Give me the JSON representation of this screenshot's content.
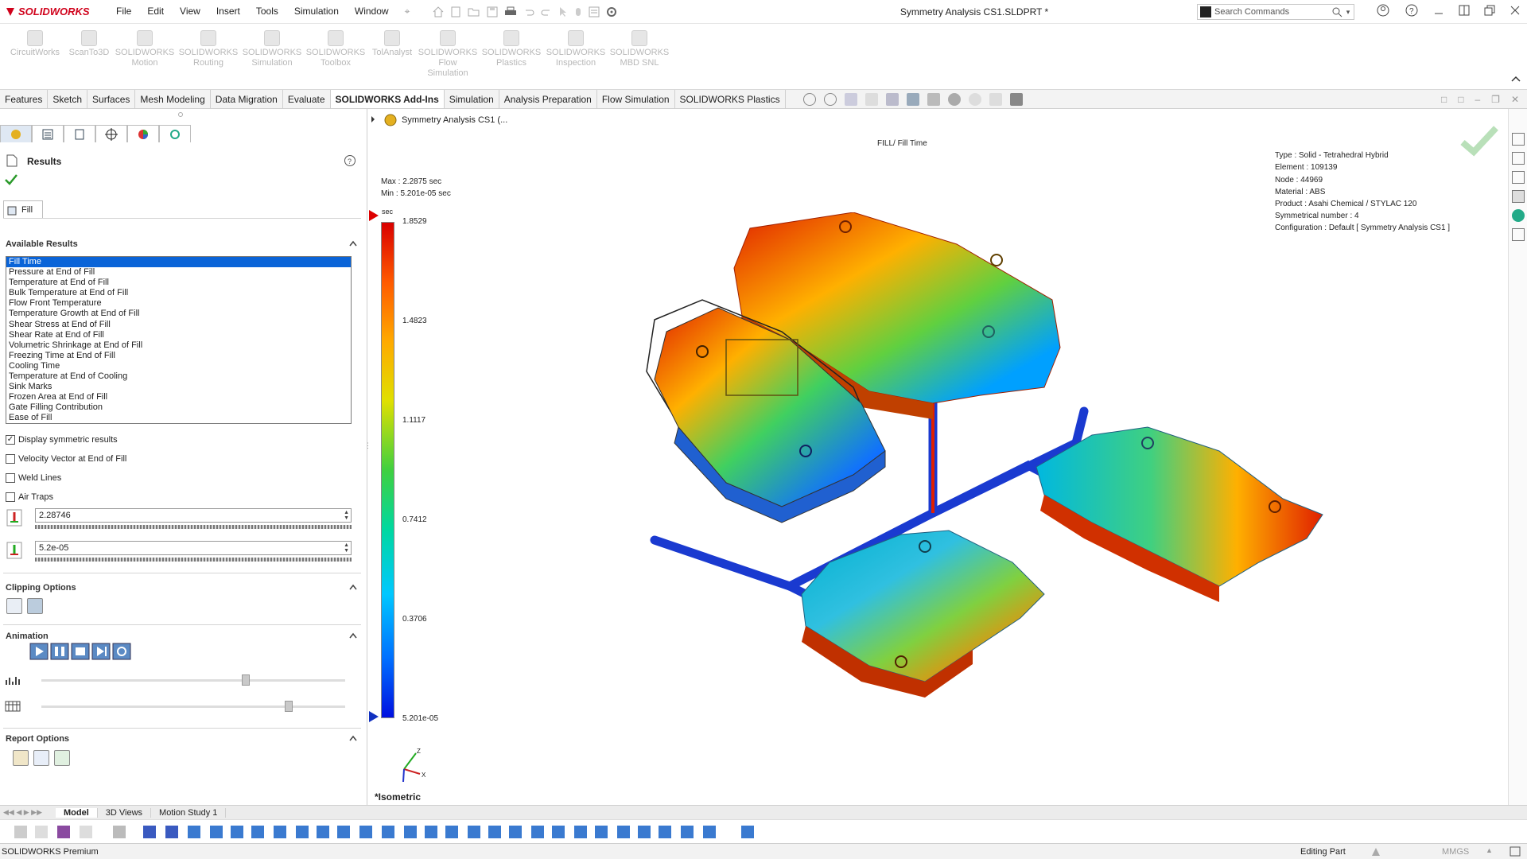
{
  "app": {
    "brand": "SOLIDWORKS",
    "document_title": "Symmetry Analysis CS1.SLDPRT *"
  },
  "menu": [
    "File",
    "Edit",
    "View",
    "Insert",
    "Tools",
    "Simulation",
    "Window"
  ],
  "search": {
    "placeholder": "Search Commands"
  },
  "addins": [
    {
      "label": "CircuitWorks"
    },
    {
      "label": "ScanTo3D"
    },
    {
      "label": "SOLIDWORKS\nMotion"
    },
    {
      "label": "SOLIDWORKS\nRouting"
    },
    {
      "label": "SOLIDWORKS\nSimulation"
    },
    {
      "label": "SOLIDWORKS\nToolbox"
    },
    {
      "label": "TolAnalyst"
    },
    {
      "label": "SOLIDWORKS\nFlow\nSimulation"
    },
    {
      "label": "SOLIDWORKS\nPlastics"
    },
    {
      "label": "SOLIDWORKS\nInspection"
    },
    {
      "label": "SOLIDWORKS\nMBD SNL"
    }
  ],
  "command_tabs": [
    "Features",
    "Sketch",
    "Surfaces",
    "Mesh Modeling",
    "Data Migration",
    "Evaluate",
    "SOLIDWORKS Add-Ins",
    "Simulation",
    "Analysis Preparation",
    "Flow Simulation",
    "SOLIDWORKS Plastics"
  ],
  "active_command_tab": "SOLIDWORKS Add-Ins",
  "panel": {
    "title": "Results",
    "subtab": "Fill",
    "available_results_title": "Available Results",
    "results": [
      "Fill Time",
      "Pressure at End of Fill",
      "Temperature at End of Fill",
      "Bulk Temperature at End of Fill",
      "Flow Front Temperature",
      "Temperature Growth at End of Fill",
      "Shear Stress at End of Fill",
      "Shear Rate at End of Fill",
      "Volumetric Shrinkage at End of Fill",
      "Freezing Time at End of Fill",
      "Cooling Time",
      "Temperature at End of Cooling",
      "Sink Marks",
      "Frozen Area at End of Fill",
      "Gate Filling Contribution",
      "Ease of Fill"
    ],
    "selected_result": "Fill Time",
    "checkboxes": [
      {
        "label": "Display symmetric results",
        "checked": true
      },
      {
        "label": "Velocity Vector at End of Fill",
        "checked": false
      },
      {
        "label": "Weld Lines",
        "checked": false
      },
      {
        "label": "Air Traps",
        "checked": false
      }
    ],
    "max_value": "2.28746",
    "min_value": "5.2e-05",
    "clipping_title": "Clipping Options",
    "animation_title": "Animation",
    "animation_speed_level": 0.66,
    "animation_frame_level": 0.8,
    "report_title": "Report Options"
  },
  "viewport": {
    "tree_label": "Symmetry Analysis CS1 (...",
    "plot_title": "FILL/ Fill Time",
    "max_text": "Max : 2.2875 sec",
    "min_text": "Min : 5.201e-05 sec",
    "legend_unit": "sec",
    "legend_ticks": [
      "1.8529",
      "1.4823",
      "1.1117",
      "0.7412",
      "0.3706",
      "5.201e-05"
    ],
    "info": [
      "Type : Solid - Tetrahedral Hybrid",
      "Element : 109139",
      "Node : 44969",
      "Material : ABS",
      "Product : Asahi Chemical / STYLAC 120",
      "Symmetrical number : 4",
      "Configuration : Default [ Symmetry Analysis CS1 ]"
    ],
    "view_label": "*Isometric"
  },
  "bottom_tabs": [
    "Model",
    "3D Views",
    "Motion Study 1"
  ],
  "status": {
    "left": "SOLIDWORKS Premium",
    "mode": "Editing Part",
    "units": "MMGS"
  },
  "colors": {
    "accent_red": "#d0021b",
    "selection_blue": "#0a64d8"
  }
}
